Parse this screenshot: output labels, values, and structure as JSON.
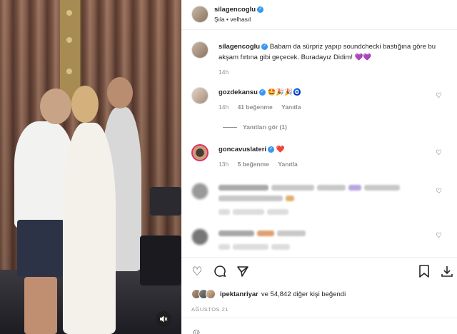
{
  "header": {
    "username": "silagencoglu",
    "subtitle": "Şıla • velhasıl"
  },
  "caption": {
    "username": "silagencoglu",
    "text": "Babam da sürpriz yapıp soundchecki bastığına göre bu akşam fırtına gibi geçecek. Buradayız Didim! 💜💜",
    "time": "14h"
  },
  "comments": [
    {
      "username": "gozdekansu",
      "text": "🤩🎉🎉🧿",
      "time": "14h",
      "likes": "41 beğenme",
      "reply": "Yanıtla"
    },
    {
      "username": "goncavuslateri",
      "text": "❤️",
      "time": "13h",
      "likes": "5 beğenme",
      "reply": "Yanıtla"
    }
  ],
  "view_replies": "Yanıtları gör (1)",
  "likes": {
    "user": "ipektanriyar",
    "rest": "ve 54,842 diğer kişi beğendi"
  },
  "date": "AĞUSTOS 21",
  "icons": {
    "like": "heart-icon",
    "comment": "comment-icon",
    "share": "share-icon",
    "save": "bookmark-icon",
    "download": "download-icon",
    "mute": "speaker-muted-icon",
    "emoji": "smiley-icon"
  }
}
